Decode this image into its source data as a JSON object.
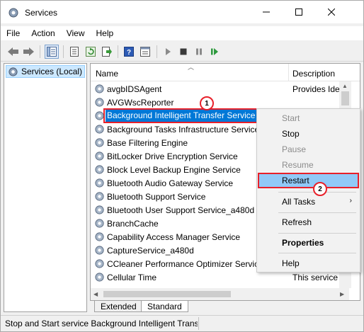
{
  "window": {
    "title": "Services"
  },
  "menubar": [
    "File",
    "Action",
    "View",
    "Help"
  ],
  "tree": {
    "root_label": "Services (Local)"
  },
  "table": {
    "headers": {
      "name": "Name",
      "description": "Description"
    },
    "rows": [
      {
        "name": "avgbIDSAgent",
        "description": "Provides Ide"
      },
      {
        "name": "AVGWscReporter",
        "description": ""
      },
      {
        "name": "Background Intelligent Transfer Service",
        "description": "",
        "selected": true
      },
      {
        "name": "Background Tasks Infrastructure Service",
        "description": ""
      },
      {
        "name": "Base Filtering Engine",
        "description": ""
      },
      {
        "name": "BitLocker Drive Encryption Service",
        "description": ""
      },
      {
        "name": "Block Level Backup Engine Service",
        "description": ""
      },
      {
        "name": "Bluetooth Audio Gateway Service",
        "description": ""
      },
      {
        "name": "Bluetooth Support Service",
        "description": ""
      },
      {
        "name": "Bluetooth User Support Service_a480d",
        "description": ""
      },
      {
        "name": "BranchCache",
        "description": ""
      },
      {
        "name": "Capability Access Manager Service",
        "description": ""
      },
      {
        "name": "CaptureService_a480d",
        "description": ""
      },
      {
        "name": "CCleaner Performance Optimizer Service",
        "description": ""
      },
      {
        "name": "Cellular Time",
        "description": "This service"
      }
    ]
  },
  "context_menu": {
    "items": [
      {
        "label": "Start",
        "state": "disabled"
      },
      {
        "label": "Stop",
        "state": "enabled"
      },
      {
        "label": "Pause",
        "state": "disabled"
      },
      {
        "label": "Resume",
        "state": "disabled"
      },
      {
        "label": "Restart",
        "state": "highlighted"
      },
      {
        "label": "All Tasks",
        "state": "submenu",
        "submenu_glyph": "›"
      },
      {
        "label": "Refresh",
        "state": "enabled"
      },
      {
        "label": "Properties",
        "state": "bold"
      },
      {
        "label": "Help",
        "state": "enabled"
      }
    ]
  },
  "tabs": [
    "Extended",
    "Standard"
  ],
  "status_text": "Stop and Start service Background Intelligent Transfer Service on Local Computer",
  "badges": [
    "1",
    "2"
  ],
  "colors": {
    "selection": "#0078d7",
    "annotation": "#e8202a",
    "menu_hover": "#91c9f7"
  },
  "icons": {
    "window": "services-gear-icon",
    "toolbar": [
      "back-arrow-icon",
      "forward-arrow-icon",
      "show-tree-icon",
      "properties-sheet-icon",
      "refresh-icon",
      "export-list-icon",
      "help-icon",
      "console-icon",
      "play-icon",
      "stop-icon",
      "pause-icon",
      "resume-icon"
    ]
  }
}
